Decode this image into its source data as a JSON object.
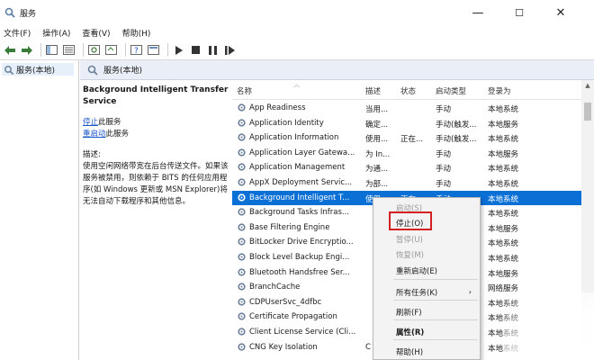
{
  "window": {
    "title": "服务",
    "controls": {
      "minimize": "—",
      "maximize": "☐",
      "close": "✕"
    }
  },
  "menu": [
    "文件(F)",
    "操作(A)",
    "查看(V)",
    "帮助(H)"
  ],
  "tree": {
    "selected": "服务(本地)"
  },
  "header": {
    "label": "服务(本地)"
  },
  "description": {
    "service_name": "Background Intelligent Transfer Service",
    "stop_link": "停止",
    "stop_suffix": "此服务",
    "restart_link": "重启动",
    "restart_suffix": "此服务",
    "label": "描述:",
    "text": "使用空闲网络带宽在后台传送文件。如果该服务被禁用，则依赖于 BITS 的任何应用程序(如 Windows 更新或 MSN Explorer)将无法自动下载程序和其他信息。"
  },
  "table": {
    "columns": [
      "名称",
      "描述",
      "状态",
      "启动类型",
      "登录为"
    ],
    "rows": [
      {
        "name": "App Readiness",
        "desc": "当用...",
        "status": "",
        "startup": "手动",
        "logon": "本地系统"
      },
      {
        "name": "Application Identity",
        "desc": "确定...",
        "status": "",
        "startup": "手动(触发...",
        "logon": "本地服务"
      },
      {
        "name": "Application Information",
        "desc": "使用...",
        "status": "正在...",
        "startup": "手动(触发...",
        "logon": "本地系统"
      },
      {
        "name": "Application Layer Gatewa...",
        "desc": "为 In...",
        "status": "",
        "startup": "手动",
        "logon": "本地服务"
      },
      {
        "name": "Application Management",
        "desc": "为通...",
        "status": "",
        "startup": "手动",
        "logon": "本地系统"
      },
      {
        "name": "AppX Deployment Servic...",
        "desc": "为部...",
        "status": "",
        "startup": "手动",
        "logon": "本地系统"
      },
      {
        "name": "Background Intelligent T...",
        "desc": "使用...",
        "status": "正在...",
        "startup": "手动",
        "logon": "本地系统"
      },
      {
        "name": "Background Tasks Infras...",
        "desc": "",
        "status": "",
        "startup": "",
        "logon": "本地系统"
      },
      {
        "name": "Base Filtering Engine",
        "desc": "",
        "status": "",
        "startup": "",
        "logon": "本地服务"
      },
      {
        "name": "BitLocker Drive Encryptio...",
        "desc": "",
        "status": "",
        "startup": "",
        "logon": "本地系统"
      },
      {
        "name": "Block Level Backup Engi...",
        "desc": "",
        "status": "",
        "startup": "",
        "logon": "本地系统"
      },
      {
        "name": "Bluetooth Handsfree Ser...",
        "desc": "",
        "status": "",
        "startup": "",
        "logon": "本地服务"
      },
      {
        "name": "BranchCache",
        "desc": "",
        "status": "",
        "startup": "",
        "logon": "网络服务"
      },
      {
        "name": "CDPUserSvc_4dfbc",
        "desc": "",
        "status": "",
        "startup": "",
        "logon": "本地系统"
      },
      {
        "name": "Certificate Propagation",
        "desc": "",
        "status": "",
        "startup": "",
        "logon": "本地系统"
      },
      {
        "name": "Client License Service (Cli...",
        "desc": "",
        "status": "",
        "startup": "",
        "logon": "本地系统"
      },
      {
        "name": "CNG Key Isolation",
        "desc": "C",
        "status": "",
        "startup": "",
        "logon": "本地系统"
      }
    ]
  },
  "context_menu": {
    "items": [
      {
        "label": "启动(S)",
        "disabled": true
      },
      {
        "label": "停止(O)",
        "disabled": false
      },
      {
        "label": "暂停(U)",
        "disabled": true
      },
      {
        "label": "恢复(M)",
        "disabled": true
      },
      {
        "label": "重新启动(E)",
        "disabled": false
      },
      {
        "label": "所有任务(K)",
        "disabled": false,
        "submenu": "›"
      },
      {
        "label": "刷新(F)",
        "disabled": false
      },
      {
        "label": "属性(R)",
        "disabled": false,
        "bold": true
      },
      {
        "label": "帮助(H)",
        "disabled": false
      }
    ]
  },
  "colors": {
    "selection": "#0a70d6",
    "link": "#1a56c9",
    "highlight_box": "#d42020",
    "header_bar": "#eaeff7"
  }
}
